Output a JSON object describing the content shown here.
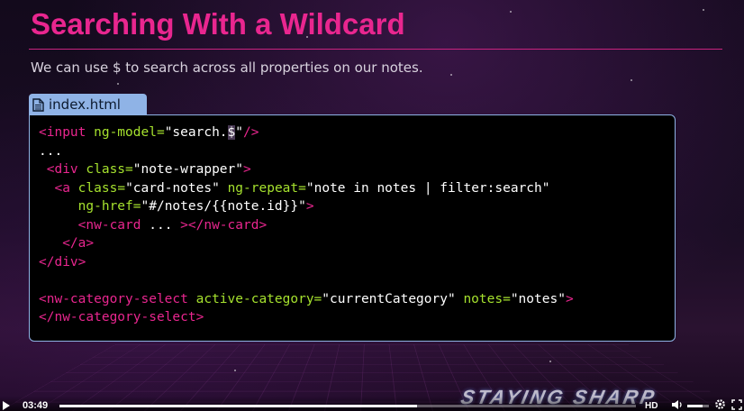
{
  "slide": {
    "title": "Searching With a Wildcard",
    "subtitle": "We can use $ to search across all properties on our notes."
  },
  "file_tab": {
    "name": "index.html",
    "icon": "document-icon"
  },
  "code": {
    "lines": [
      [
        [
          "tag",
          "<input "
        ],
        [
          "attr",
          "ng-model="
        ],
        [
          "str",
          "\"search."
        ],
        [
          "hl",
          "$"
        ],
        [
          "str",
          "\""
        ],
        [
          "tag",
          "/>"
        ]
      ],
      [
        [
          "plain",
          "..."
        ]
      ],
      [
        [
          "plain",
          " "
        ],
        [
          "tag",
          "<div "
        ],
        [
          "attr",
          "class="
        ],
        [
          "str",
          "\"note-wrapper\""
        ],
        [
          "tag",
          ">"
        ]
      ],
      [
        [
          "plain",
          "  "
        ],
        [
          "tag",
          "<a "
        ],
        [
          "attr",
          "class="
        ],
        [
          "str",
          "\"card-notes\" "
        ],
        [
          "attr",
          "ng-repeat="
        ],
        [
          "str",
          "\"note in notes | filter:search\""
        ]
      ],
      [
        [
          "plain",
          "     "
        ],
        [
          "attr",
          "ng-href="
        ],
        [
          "str",
          "\"#/notes/{{note.id}}\""
        ],
        [
          "tag",
          ">"
        ]
      ],
      [
        [
          "plain",
          "     "
        ],
        [
          "tag",
          "<nw-card "
        ],
        [
          "plain",
          "... "
        ],
        [
          "tag",
          "></nw-card>"
        ]
      ],
      [
        [
          "plain",
          "   "
        ],
        [
          "tag",
          "</a>"
        ]
      ],
      [
        [
          "tag",
          "</div>"
        ]
      ],
      [
        [
          "plain",
          ""
        ]
      ],
      [
        [
          "tag",
          "<nw-category-select "
        ],
        [
          "attr",
          "active-category="
        ],
        [
          "str",
          "\"currentCategory\" "
        ],
        [
          "attr",
          "notes="
        ],
        [
          "str",
          "\"notes\""
        ],
        [
          "tag",
          ">"
        ]
      ],
      [
        [
          "tag",
          "</nw-category-select>"
        ]
      ]
    ]
  },
  "player": {
    "time": "03:49",
    "progress_fraction": 0.62,
    "brand_text": "STAYING SHARP",
    "hd_label": "HD",
    "volume_fraction": 0.7,
    "play_icon": "play-icon",
    "volume_icon": "volume-icon",
    "settings_icon": "gear-icon",
    "fullscreen_icon": "fullscreen-icon"
  },
  "colors": {
    "title": "#e9268f",
    "tag": "#e9268f",
    "attribute": "#a6e22e",
    "tab_background": "#8fb3e6"
  }
}
